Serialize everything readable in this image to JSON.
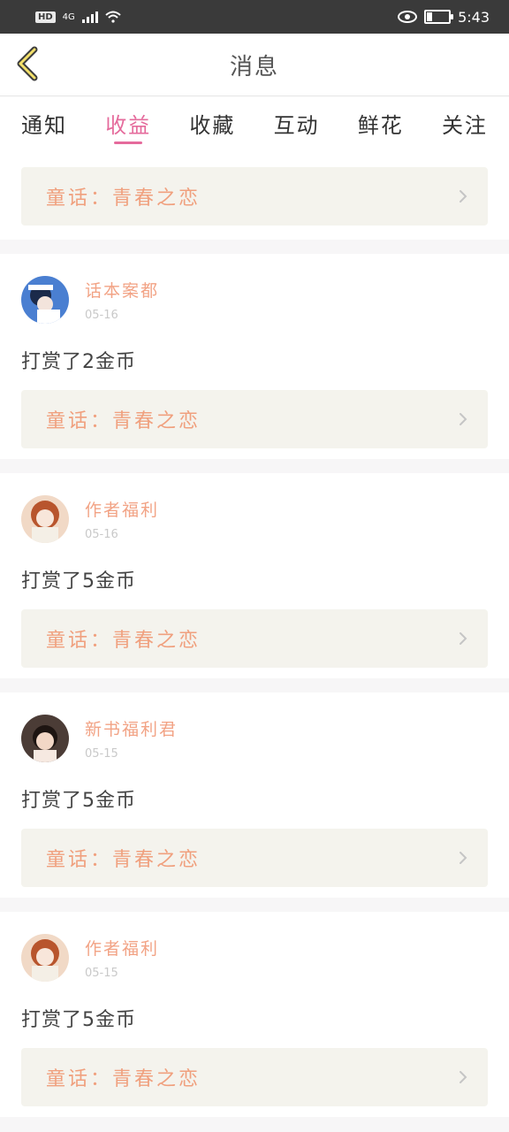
{
  "status_bar": {
    "hd": "HD",
    "network": "4G",
    "time": "5:43"
  },
  "header": {
    "title": "消息"
  },
  "tabs": [
    {
      "label": "通知",
      "active": false
    },
    {
      "label": "收益",
      "active": true
    },
    {
      "label": "收藏",
      "active": false
    },
    {
      "label": "互动",
      "active": false
    },
    {
      "label": "鲜花",
      "active": false
    },
    {
      "label": "关注",
      "active": false
    }
  ],
  "top_card": {
    "book": "童话：青春之恋"
  },
  "messages": [
    {
      "user": "话本案都",
      "date": "05-16",
      "text": "打赏了2金币",
      "book": "童话：青春之恋"
    },
    {
      "user": "作者福利",
      "date": "05-16",
      "text": "打赏了5金币",
      "book": "童话：青春之恋"
    },
    {
      "user": "新书福利君",
      "date": "05-15",
      "text": "打赏了5金币",
      "book": "童话：青春之恋"
    },
    {
      "user": "作者福利",
      "date": "05-15",
      "text": "打赏了5金币",
      "book": "童话：青春之恋"
    }
  ],
  "colors": {
    "accent": "#e56b9c",
    "username": "#f2a385",
    "book_title": "#f0a07e",
    "book_bg": "#f4f3ed"
  }
}
